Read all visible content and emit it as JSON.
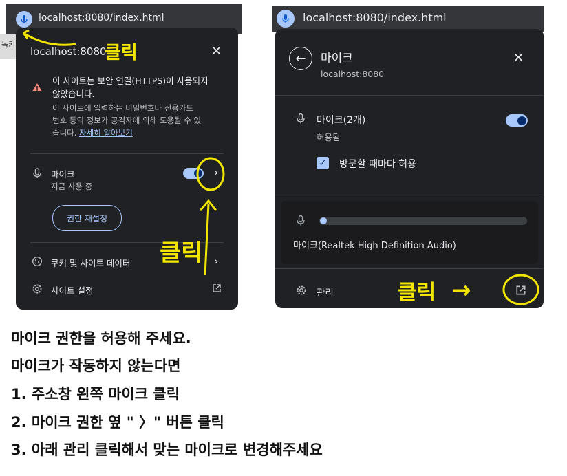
{
  "left_browser": {
    "url": "localhost:8080/index.html",
    "tab_fragment": "독키"
  },
  "left_popup": {
    "site": "localhost:8080",
    "warning_line1": "이 사이트는 보안 연결(HTTPS)이 사용되지",
    "warning_line2": "않았습니다.",
    "info_line1": "이 사이트에 입력하는 비밀번호나 신용카드",
    "info_line2": "번호 등의 정보가 공격자에 의해 도용될 수 있",
    "info_line3": "습니다.",
    "learn_more": "자세히 알아보기",
    "mic_label": "마이크",
    "mic_status": "지금 사용 중",
    "reset_button": "권한 재설정",
    "cookies_label": "쿠키 및 사이트 데이터",
    "site_settings_label": "사이트 설정"
  },
  "right_browser": {
    "url": "localhost:8080/index.html"
  },
  "right_popup": {
    "title": "마이크",
    "site": "localhost:8080",
    "mic_label": "마이크(2개)",
    "mic_status": "허용됨",
    "checkbox_label": "방문할 때마다 허용",
    "device_label": "마이크(Realtek High Definition Audio)",
    "manage_label": "관리",
    "mic_level": 0
  },
  "annotations": {
    "click1": "클릭",
    "click2": "클릭",
    "click3": "클릭",
    "arrow": "→"
  },
  "instructions": [
    "마이크 권한을 허용해 주세요.",
    "마이크가 작동하지 않는다면",
    "1. 주소창 왼쪽 마이크 클릭",
    "2. 마이크 권한 옆 \" 〉\" 버튼 클릭",
    "3. 아래 관리 클릭해서 맞는 마이크로 변경해주세요"
  ],
  "colors": {
    "panel_bg": "#202124",
    "accent": "#a8c7fa",
    "warning": "#f28b82",
    "annotation": "#f2e600"
  }
}
